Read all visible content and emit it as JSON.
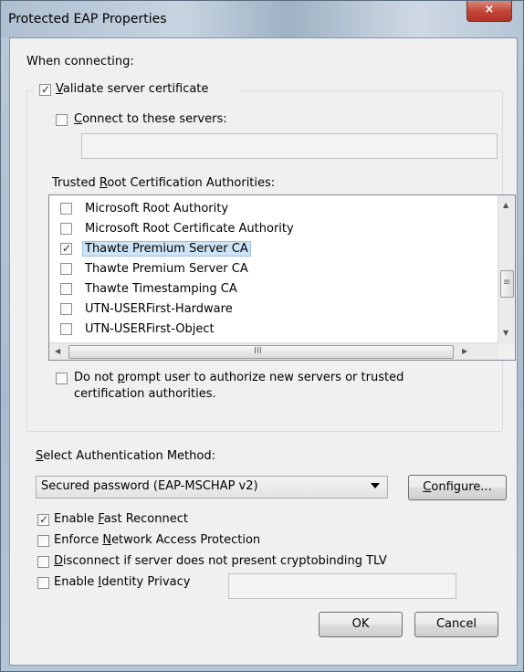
{
  "window": {
    "title": "Protected EAP Properties",
    "close_glyph": "×"
  },
  "when_connecting": {
    "label": "When connecting:",
    "validate_cert": {
      "accel": "V",
      "rest": "alidate server certificate",
      "checked": true
    },
    "connect_servers": {
      "pre": "",
      "accel": "C",
      "rest": "onnect to these servers:",
      "checked": false,
      "value": ""
    }
  },
  "trusted_root": {
    "pre": "Trusted ",
    "accel": "R",
    "rest": "oot Certification Authorities:",
    "items": [
      {
        "label": "Microsoft Root Authority",
        "checked": false,
        "selected": false
      },
      {
        "label": "Microsoft Root Certificate Authority",
        "checked": false,
        "selected": false
      },
      {
        "label": "Thawte Premium Server CA",
        "checked": true,
        "selected": true
      },
      {
        "label": "Thawte Premium Server CA",
        "checked": false,
        "selected": false
      },
      {
        "label": "Thawte Timestamping CA",
        "checked": false,
        "selected": false
      },
      {
        "label": "UTN-USERFirst-Hardware",
        "checked": false,
        "selected": false
      },
      {
        "label": "UTN-USERFirst-Object",
        "checked": false,
        "selected": false
      }
    ],
    "hscroll_grip": "III",
    "vscroll_grip": "≡"
  },
  "no_prompt": {
    "pre": "Do not ",
    "accel": "p",
    "rest": "rompt user to authorize new servers or trusted",
    "line2": "certification authorities.",
    "checked": false
  },
  "auth_method": {
    "accel": "S",
    "rest": "elect Authentication Method:",
    "selected": "Secured password (EAP-MSCHAP v2)",
    "configure": {
      "accel": "C",
      "rest": "onfigure..."
    }
  },
  "options": {
    "fast_reconnect": {
      "pre": "Enable ",
      "accel": "F",
      "rest": "ast Reconnect",
      "checked": true
    },
    "nap": {
      "pre": "Enforce ",
      "accel": "N",
      "rest": "etwork Access Protection",
      "checked": false
    },
    "cryptobinding": {
      "pre": "",
      "accel": "D",
      "rest": "isconnect if server does not present cryptobinding TLV",
      "checked": false
    },
    "identity_privacy": {
      "pre": "Enable ",
      "accel": "I",
      "rest": "dentity Privacy",
      "checked": false,
      "value": ""
    }
  },
  "buttons": {
    "ok": "OK",
    "cancel": "Cancel"
  }
}
